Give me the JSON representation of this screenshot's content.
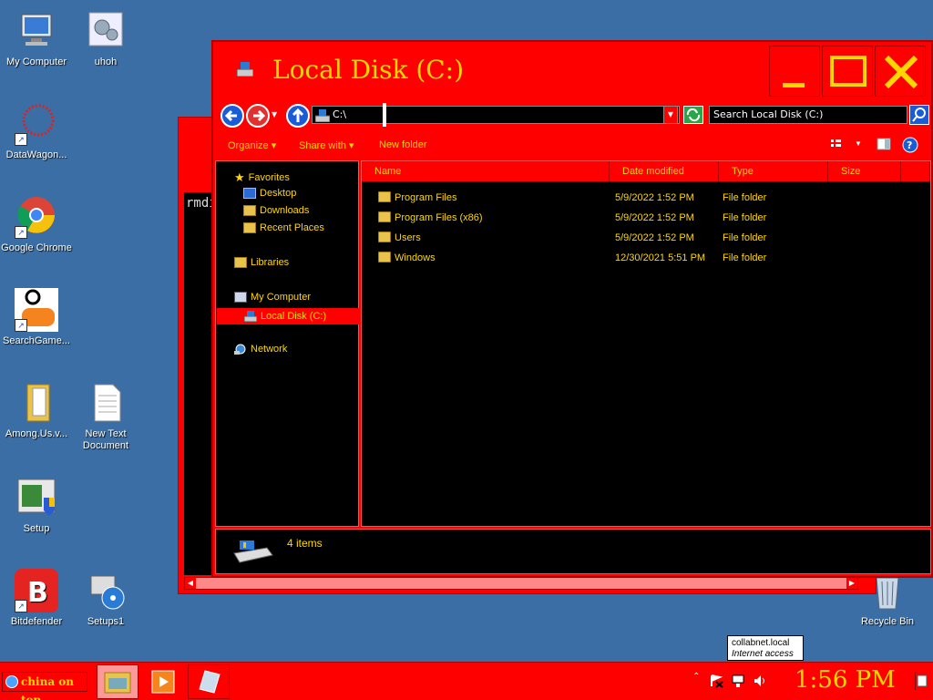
{
  "desktop": {
    "icons": [
      {
        "label": "My Computer"
      },
      {
        "label": "uhoh"
      },
      {
        "label": "DataWagon..."
      },
      {
        "label": "Google Chrome"
      },
      {
        "label": "SearchGame..."
      },
      {
        "label": "Among.Us.v..."
      },
      {
        "label": "New Text Document"
      },
      {
        "label": "Setup"
      },
      {
        "label": "Bitdefender"
      },
      {
        "label": "Setups1"
      },
      {
        "label": "Recycle Bin"
      }
    ]
  },
  "terminal": {
    "text": "rmdi"
  },
  "explorer": {
    "title": "Local Disk (C:)",
    "address": "C:\\",
    "search_placeholder": "Search Local Disk (C:)",
    "commands": {
      "organize": "Organize",
      "share": "Share with",
      "new_folder": "New folder"
    },
    "nav": {
      "favorites": "Favorites",
      "desktop": "Desktop",
      "downloads": "Downloads",
      "recent": "Recent Places",
      "libraries": "Libraries",
      "computer": "My Computer",
      "local_disk": "Local Disk (C:)",
      "network": "Network"
    },
    "columns": {
      "name": "Name",
      "date": "Date modified",
      "type": "Type",
      "size": "Size"
    },
    "files": [
      {
        "name": "Program Files",
        "date": "5/9/2022 1:52 PM",
        "type": "File folder"
      },
      {
        "name": "Program Files (x86)",
        "date": "5/9/2022 1:52 PM",
        "type": "File folder"
      },
      {
        "name": "Users",
        "date": "5/9/2022 1:52 PM",
        "type": "File folder"
      },
      {
        "name": "Windows",
        "date": "12/30/2021 5:51 PM",
        "type": "File folder"
      }
    ],
    "status": "4 items"
  },
  "tooltip": {
    "line1": "collabnet.local",
    "line2": "Internet access"
  },
  "taskbar": {
    "start_label": "china on top",
    "clock": "1:56 PM"
  }
}
